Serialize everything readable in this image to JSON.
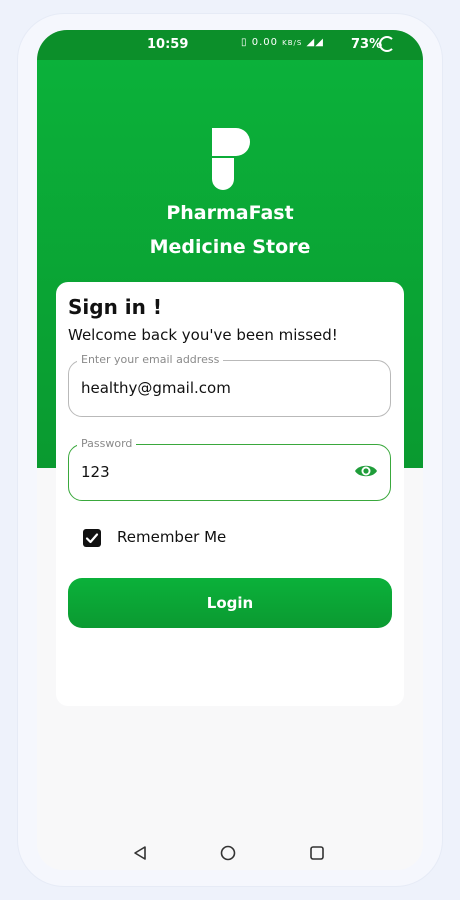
{
  "status_bar": {
    "time": "10:59",
    "speed": "0.00",
    "speed_unit": "KB/S",
    "battery": "73%"
  },
  "brand": {
    "name": "PharmaFast",
    "subtitle": "Medicine Store",
    "logo_icon": "pharmafast-logo-icon"
  },
  "signin": {
    "title": "Sign in !",
    "subtitle": "Welcome back you've been missed!"
  },
  "email_field": {
    "label": "Enter your email address",
    "value": "healthy@gmail.com"
  },
  "password_field": {
    "label": "Password",
    "value": "123",
    "toggle_icon": "eye-icon"
  },
  "remember": {
    "label": "Remember Me",
    "checked": true
  },
  "login_button": {
    "label": "Login"
  },
  "nav": {
    "back_icon": "back-triangle-icon",
    "home_icon": "home-circle-icon",
    "recents_icon": "recents-square-icon"
  },
  "colors": {
    "primary": "#0bb13a",
    "primary_dark": "#0a9a30",
    "accent_border": "#3aa83d"
  }
}
